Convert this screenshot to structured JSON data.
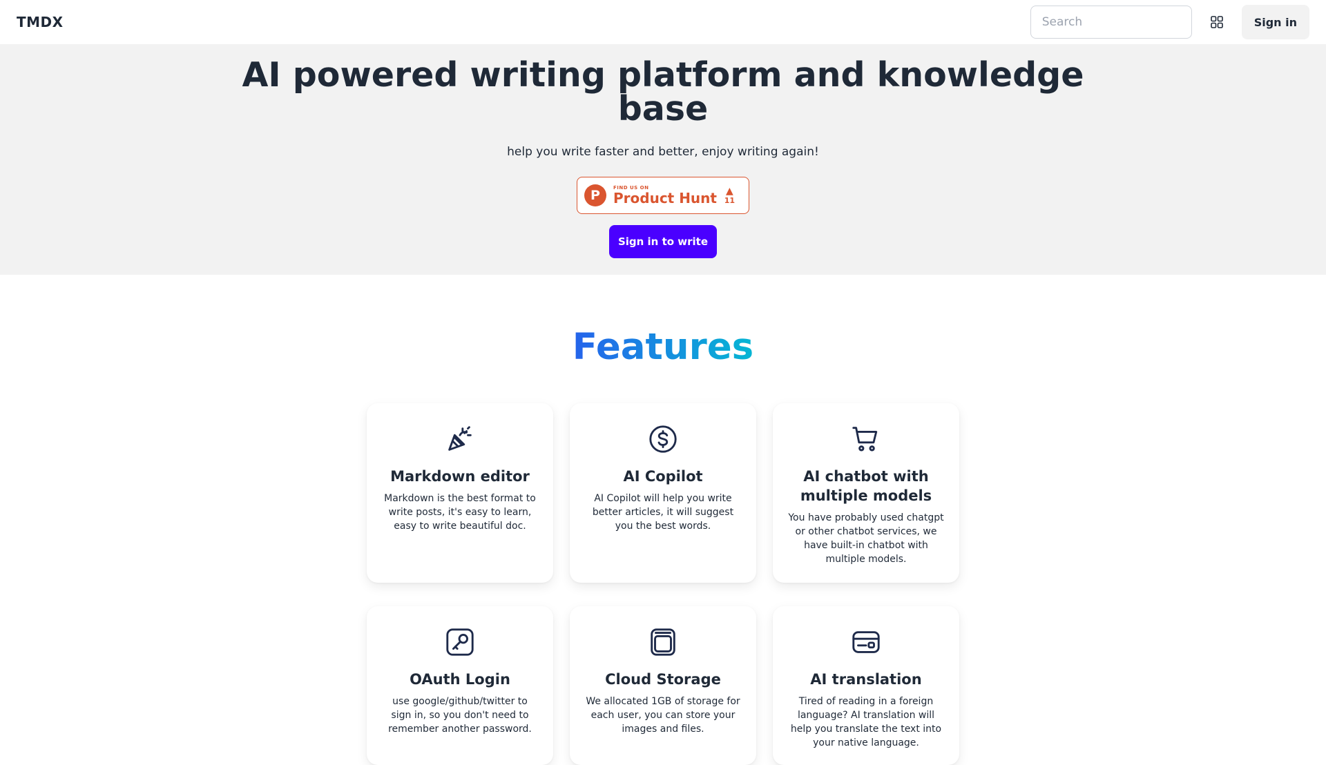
{
  "header": {
    "brand": "TMDX",
    "search_placeholder": "Search",
    "signin_label": "Sign in"
  },
  "hero": {
    "title": "AI powered writing platform and knowledge base",
    "subtitle": "help you write faster and better, enjoy writing again!",
    "product_hunt": {
      "small_text": "FIND US ON",
      "big_text": "Product Hunt",
      "logo_letter": "P",
      "arrow": "▲",
      "votes": "11",
      "color": "#da552f"
    },
    "cta_label": "Sign in to write",
    "cta_color": "#4a00ff"
  },
  "features": {
    "title": "Features",
    "items": [
      {
        "icon": "party-popper-icon",
        "title": "Markdown editor",
        "desc": "Markdown is the best format to write posts, it's easy to learn, easy to write beautiful doc."
      },
      {
        "icon": "dollar-circle-icon",
        "title": "AI Copilot",
        "desc": "AI Copilot will help you write better articles, it will suggest you the best words."
      },
      {
        "icon": "shopping-cart-icon",
        "title": "AI chatbot with multiple models",
        "desc": "You have probably used chatgpt or other chatbot services, we have built-in chatbot with multiple models."
      },
      {
        "icon": "key-icon",
        "title": "OAuth Login",
        "desc": "use google/github/twitter to sign in, so you don't need to remember another password."
      },
      {
        "icon": "storage-icon",
        "title": "Cloud Storage",
        "desc": "We allocated 1GB of storage for each user, you can store your images and files."
      },
      {
        "icon": "id-card-icon",
        "title": "AI translation",
        "desc": "Tired of reading in a foreign language? AI translation will help you translate the text into your native language."
      }
    ]
  }
}
